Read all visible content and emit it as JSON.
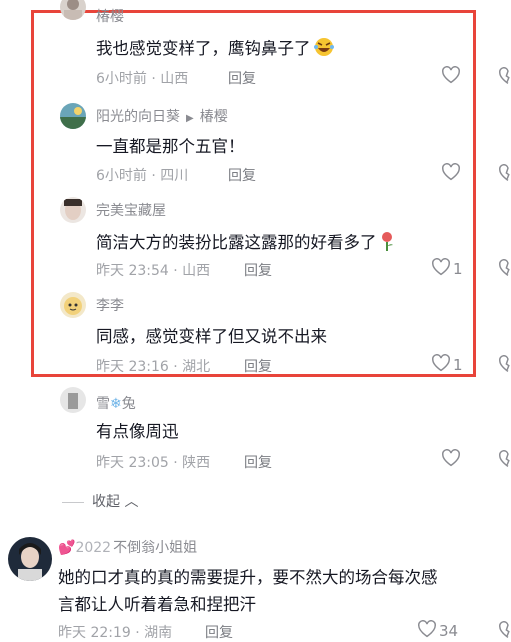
{
  "comments": [
    {
      "name": "椿樱",
      "text": "我也感觉变样了，鹰钩鼻子了",
      "time": "6小时前 · 山西",
      "reply": "回复",
      "likes": "",
      "emoji": "laughing-emoji"
    },
    {
      "name": "阳光的向日葵",
      "reply_to": "椿樱",
      "text": "一直都是那个五官！",
      "time": "6小时前 · 四川",
      "reply": "回复",
      "likes": ""
    },
    {
      "name": "完美宝藏屋",
      "text": "简洁大方的装扮比露这露那的好看多了",
      "time": "昨天 23:54 · 山西",
      "reply": "回复",
      "likes": "1",
      "emoji": "rose-emoji"
    },
    {
      "name": "李李",
      "text": "同感，感觉变样了但又说不出来",
      "time": "昨天 23:16 · 湖北",
      "reply": "回复",
      "likes": "1"
    },
    {
      "name_prefix": "雪",
      "name_suffix": "兔",
      "text": "有点像周迅",
      "time": "昨天 23:05 · 陕西",
      "reply": "回复",
      "likes": ""
    }
  ],
  "collapse_label": "收起",
  "top_comment": {
    "badge": "2022",
    "name": "不倒翁小姐姐",
    "text_line1": "她的口才真的真的需要提升，要不然大的场合每次感",
    "text_line2": "言都让人听着着急和捏把汗",
    "time": "昨天 22:19 · 湖南",
    "reply": "回复",
    "likes": "34"
  },
  "colors": {
    "highlight": "#e8443a",
    "secondary": "#8a8b91",
    "primary": "#161823"
  }
}
